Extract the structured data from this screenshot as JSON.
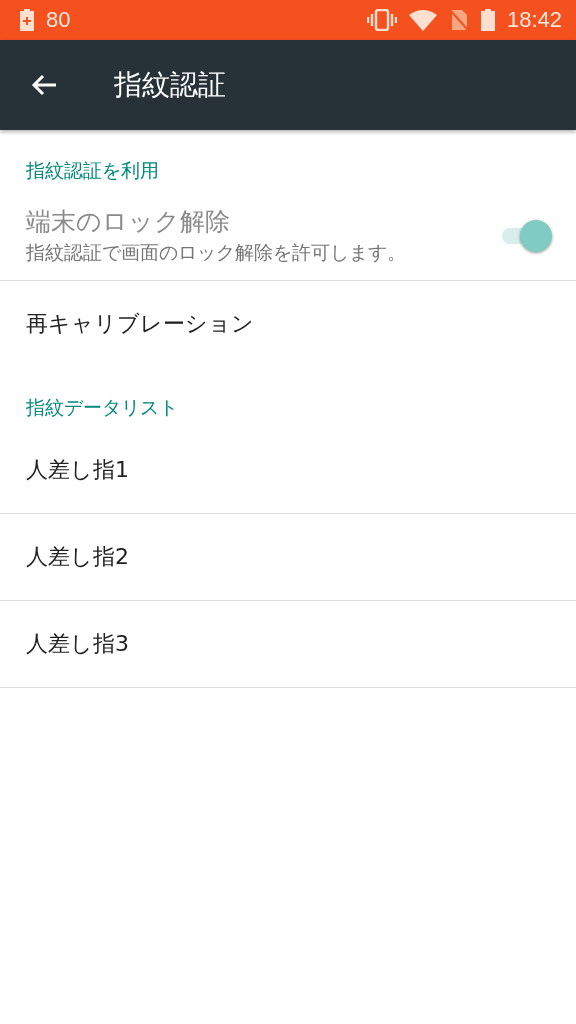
{
  "status_bar": {
    "left_text": "80",
    "time": "18:42"
  },
  "toolbar": {
    "title": "指紋認証"
  },
  "sections": [
    {
      "header": "指紋認証を利用",
      "items": [
        {
          "kind": "switch",
          "title": "端末のロック解除",
          "summary": "指紋認証で画面のロック解除を許可します。",
          "on": true,
          "disabled": true
        },
        {
          "kind": "plain",
          "title": "再キャリブレーション"
        }
      ]
    },
    {
      "header": "指紋データリスト",
      "items": [
        {
          "kind": "plain",
          "title": "人差し指1"
        },
        {
          "kind": "plain",
          "title": "人差し指2"
        },
        {
          "kind": "plain",
          "title": "人差し指3"
        }
      ]
    }
  ]
}
